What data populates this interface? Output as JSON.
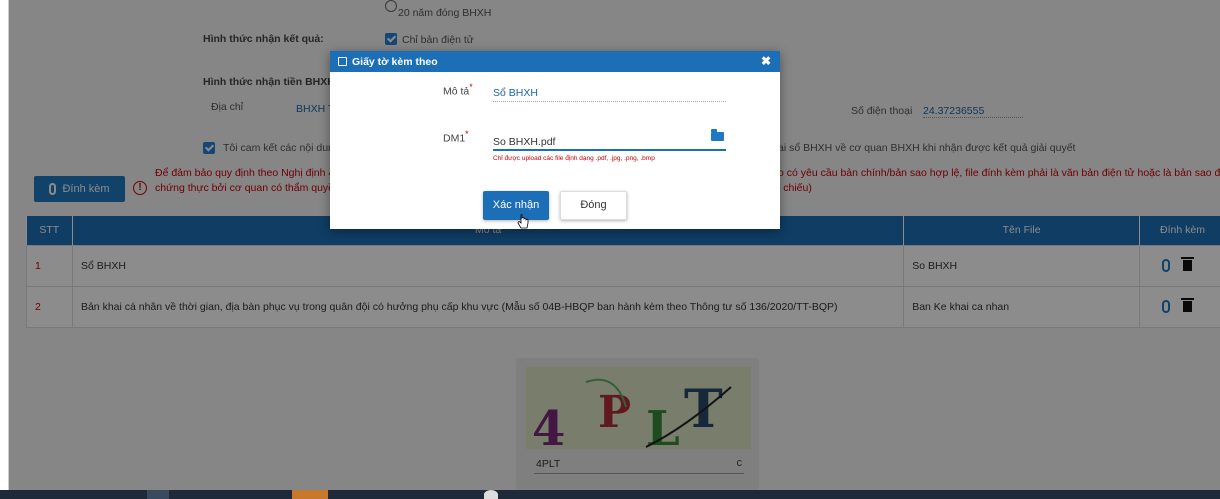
{
  "form": {
    "radio_option": "20 năm đóng BHXH",
    "ket_qua_label": "Hình thức nhận kết quả:",
    "ket_qua_value": "Chỉ bản điện tử",
    "tien_label": "Hình thức nhận tiền BHXH",
    "dia_chi_label": "Địa chỉ",
    "dia_chi_value": "BHXH T",
    "sdt_label": "Số điện thoại",
    "sdt_value": "24.37236555",
    "cam_ket_left": "Tôi cam kết các nội dung",
    "cam_ket_right": "ai sổ BHXH về cơ quan BHXH khi nhận được kết quả giải quyết",
    "notice_line1_left": "Để đảm bảo quy định theo Nghị định 45/",
    "notice_line1_right": "o có yêu cầu bản chính/bản sao hợp lệ, file đính kèm phải là văn bản điện tử hoặc là bản sao điện tử",
    "notice_line2_left": "chứng thực bởi cơ quan có thẩm quyền",
    "notice_line2_right": "i chiếu)",
    "attach_button": "Đính kèm",
    "alert_glyph": "!"
  },
  "table": {
    "headers": [
      "STT",
      "Mô tả",
      "Tên File",
      "Đính kèm"
    ],
    "rows": [
      {
        "stt": "1",
        "mo_ta": "Sổ BHXH",
        "ten_file": "So BHXH"
      },
      {
        "stt": "2",
        "mo_ta": "Bản khai cá nhân về thời gian, địa bàn phục vụ trong quân đội có hưởng phụ cấp khu vực (Mẫu số 04B-HBQP ban hành kèm theo Thông tư số 136/2020/TT-BQP)",
        "ten_file": "Ban Ke khai ca nhan"
      }
    ]
  },
  "captcha": {
    "chars": [
      "4",
      "P",
      "L",
      "T"
    ],
    "input_value": "4PLT",
    "refresh_glyph": "c"
  },
  "modal": {
    "title": "Giấy tờ kèm theo",
    "close_glyph": "✖",
    "mo_ta_label": "Mô tả",
    "mo_ta_value": "Sổ BHXH",
    "dm1_label": "DM1",
    "required_mark": "*",
    "dm1_value": "So BHXH.pdf",
    "hint": "Chỉ được upload các file định dạng .pdf, .jpg, .png, .bmp",
    "confirm_button": "Xác nhận",
    "close_button": "Đóng"
  },
  "colors": {
    "primary": "#1c6fb6",
    "danger": "#c00000",
    "overlay": "rgba(0,0,0,0.45)"
  }
}
